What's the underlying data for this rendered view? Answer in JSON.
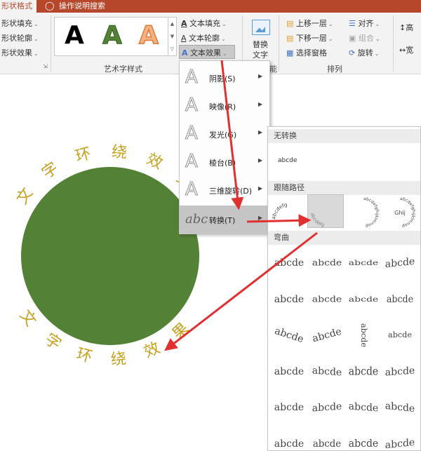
{
  "titlebar": {
    "tab": "形状格式",
    "tell_me": "操作说明搜索"
  },
  "ribbon": {
    "shape_fill": "形状填充",
    "shape_outline": "形状轮廓",
    "shape_effects": "形状效果",
    "wordart_styles_label": "艺术字样式",
    "wordart_presets": [
      {
        "letter": "A",
        "color": "#000000",
        "style": "plain"
      },
      {
        "letter": "A",
        "color": "#538135",
        "style": "outlined"
      },
      {
        "letter": "A",
        "color": "#f4b183",
        "style": "outlined-orange"
      }
    ],
    "text_fill": "文本填充",
    "text_outline": "文本轮廓",
    "text_effects": "文本效果",
    "alt_text": [
      "替换",
      "文字"
    ],
    "alt_group_label": "能",
    "bring_forward": "上移一层",
    "send_backward": "下移一层",
    "selection_pane": "选择窗格",
    "align": "对齐",
    "group": "组合",
    "rotate": "旋转",
    "arrange_label": "排列",
    "height": "高",
    "width": "宽"
  },
  "canvas": {
    "arc_text_top": "文字环绕效果",
    "arc_text_bottom": "文字环绕效果",
    "circle_color": "#538135",
    "text_color": "#c6a01e"
  },
  "effects_menu": {
    "items": [
      {
        "label": "阴影(S)"
      },
      {
        "label": "映像(R)"
      },
      {
        "label": "发光(G)"
      },
      {
        "label": "棱台(B)"
      },
      {
        "label": "三维旋转(D)"
      },
      {
        "label": "转换(T)",
        "icon_text": "abc"
      }
    ]
  },
  "transform_menu": {
    "no_transform_header": "无转换",
    "no_transform_sample": "abcde",
    "follow_path_header": "跟随路径",
    "path_samples": [
      "abcdefg",
      "abcdefg",
      "abcdefghijklmnop",
      "abcdefghijklmnop"
    ],
    "warp_header": "弯曲",
    "warp_sample": "abcde",
    "warp_rows": 6
  },
  "colors": {
    "accent": "#b7472a",
    "arrow": "#e03030",
    "ribbon_bg": "#f3f3f3",
    "selected_item": "#c5c5c5"
  }
}
